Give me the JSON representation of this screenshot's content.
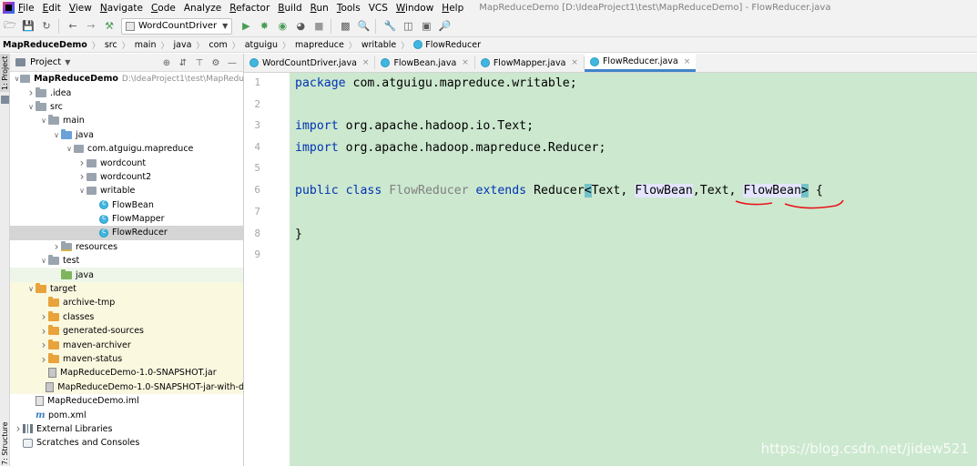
{
  "menu": {
    "items": [
      {
        "mnemonic": "F",
        "rest": "ile"
      },
      {
        "mnemonic": "E",
        "rest": "dit"
      },
      {
        "mnemonic": "V",
        "rest": "iew"
      },
      {
        "mnemonic": "N",
        "rest": "avigate"
      },
      {
        "mnemonic": "C",
        "rest": "ode"
      },
      {
        "mnemonic": "",
        "rest": "Analyze"
      },
      {
        "mnemonic": "R",
        "rest": "efactor"
      },
      {
        "mnemonic": "B",
        "rest": "uild"
      },
      {
        "mnemonic": "R",
        "rest": "un"
      },
      {
        "mnemonic": "T",
        "rest": "ools"
      },
      {
        "mnemonic": "",
        "rest": "VCS"
      },
      {
        "mnemonic": "W",
        "rest": "indow"
      },
      {
        "mnemonic": "H",
        "rest": "elp"
      }
    ],
    "window_title": "MapReduceDemo [D:\\IdeaProject1\\test\\MapReduceDemo] - FlowReducer.java"
  },
  "toolbar": {
    "run_config": "WordCountDriver"
  },
  "breadcrumb": {
    "items": [
      "MapReduceDemo",
      "src",
      "main",
      "java",
      "com",
      "atguigu",
      "mapreduce",
      "writable",
      "FlowReducer"
    ]
  },
  "left_strip": {
    "project_label": "1: Project",
    "structure_label": "7: Structure"
  },
  "project_panel": {
    "title": "Project",
    "tree": [
      {
        "depth": 0,
        "arrow": "down",
        "icon": "project",
        "label": "MapReduceDemo",
        "extra": "D:\\IdeaProject1\\test\\MapRedu",
        "bold": true
      },
      {
        "depth": 1,
        "arrow": "right",
        "icon": "folder",
        "label": ".idea"
      },
      {
        "depth": 1,
        "arrow": "down",
        "icon": "folder",
        "label": "src"
      },
      {
        "depth": 2,
        "arrow": "down",
        "icon": "folder",
        "label": "main"
      },
      {
        "depth": 3,
        "arrow": "down",
        "icon": "folder-blue",
        "label": "java"
      },
      {
        "depth": 4,
        "arrow": "down",
        "icon": "package",
        "label": "com.atguigu.mapreduce"
      },
      {
        "depth": 5,
        "arrow": "right",
        "icon": "package",
        "label": "wordcount"
      },
      {
        "depth": 5,
        "arrow": "right",
        "icon": "package",
        "label": "wordcount2"
      },
      {
        "depth": 5,
        "arrow": "down",
        "icon": "package",
        "label": "writable"
      },
      {
        "depth": 6,
        "arrow": "",
        "icon": "class",
        "label": "FlowBean"
      },
      {
        "depth": 6,
        "arrow": "",
        "icon": "class",
        "label": "FlowMapper"
      },
      {
        "depth": 6,
        "arrow": "",
        "icon": "class",
        "label": "FlowReducer",
        "selected": true
      },
      {
        "depth": 3,
        "arrow": "right",
        "icon": "folder-res",
        "label": "resources"
      },
      {
        "depth": 2,
        "arrow": "down",
        "icon": "folder",
        "label": "test"
      },
      {
        "depth": 3,
        "arrow": "",
        "icon": "folder-green",
        "label": "java",
        "testsrc": true
      },
      {
        "depth": 1,
        "arrow": "down",
        "icon": "folder-orange",
        "label": "target",
        "excluded": true
      },
      {
        "depth": 2,
        "arrow": "",
        "icon": "folder-orange",
        "label": "archive-tmp",
        "excluded": true
      },
      {
        "depth": 2,
        "arrow": "right",
        "icon": "folder-orange",
        "label": "classes",
        "excluded": true
      },
      {
        "depth": 2,
        "arrow": "right",
        "icon": "folder-orange",
        "label": "generated-sources",
        "excluded": true
      },
      {
        "depth": 2,
        "arrow": "right",
        "icon": "folder-orange",
        "label": "maven-archiver",
        "excluded": true
      },
      {
        "depth": 2,
        "arrow": "right",
        "icon": "folder-orange",
        "label": "maven-status",
        "excluded": true
      },
      {
        "depth": 2,
        "arrow": "",
        "icon": "jar",
        "label": "MapReduceDemo-1.0-SNAPSHOT.jar",
        "excluded": true
      },
      {
        "depth": 2,
        "arrow": "",
        "icon": "jar",
        "label": "MapReduceDemo-1.0-SNAPSHOT-jar-with-d",
        "excluded": true
      },
      {
        "depth": 1,
        "arrow": "",
        "icon": "iml",
        "label": "MapReduceDemo.iml"
      },
      {
        "depth": 1,
        "arrow": "",
        "icon": "pom",
        "label": "pom.xml"
      },
      {
        "depth": 0,
        "arrow": "right",
        "icon": "library",
        "label": "External Libraries"
      },
      {
        "depth": 0,
        "arrow": "",
        "icon": "scratch",
        "label": "Scratches and Consoles"
      }
    ]
  },
  "editor": {
    "tabs": [
      {
        "label": "WordCountDriver.java",
        "active": false
      },
      {
        "label": "FlowBean.java",
        "active": false
      },
      {
        "label": "FlowMapper.java",
        "active": false
      },
      {
        "label": "FlowReducer.java",
        "active": true
      }
    ],
    "line_numbers": [
      "1",
      "2",
      "3",
      "4",
      "5",
      "6",
      "7",
      "8",
      "9"
    ],
    "code": {
      "l1_kw": "package",
      "l1_rest": " com.atguigu.mapreduce.writable;",
      "l3_kw": "import",
      "l3_rest": " org.apache.hadoop.io.Text;",
      "l4_kw": "import",
      "l4_rest": " org.apache.hadoop.mapreduce.Reducer;",
      "l6_kw1": "public",
      "l6_kw2": "class",
      "l6_name": "FlowReducer",
      "l6_kw3": "extends",
      "l6_super": "Reducer",
      "l6_lt": "<",
      "l6_t1": "Text",
      "l6_c1": ", ",
      "l6_t2": "FlowBean",
      "l6_c2": ",",
      "l6_t3": "Text",
      "l6_c3": ", ",
      "l6_t4": "FlowBean",
      "l6_gt": ">",
      "l6_end": " {",
      "l8": "}"
    },
    "watermark": "https://blog.csdn.net/jidew521"
  },
  "colors": {
    "editor_bg": "#cce8cf",
    "keyword": "#0033b3",
    "annotation_ink": "#e8141b"
  }
}
